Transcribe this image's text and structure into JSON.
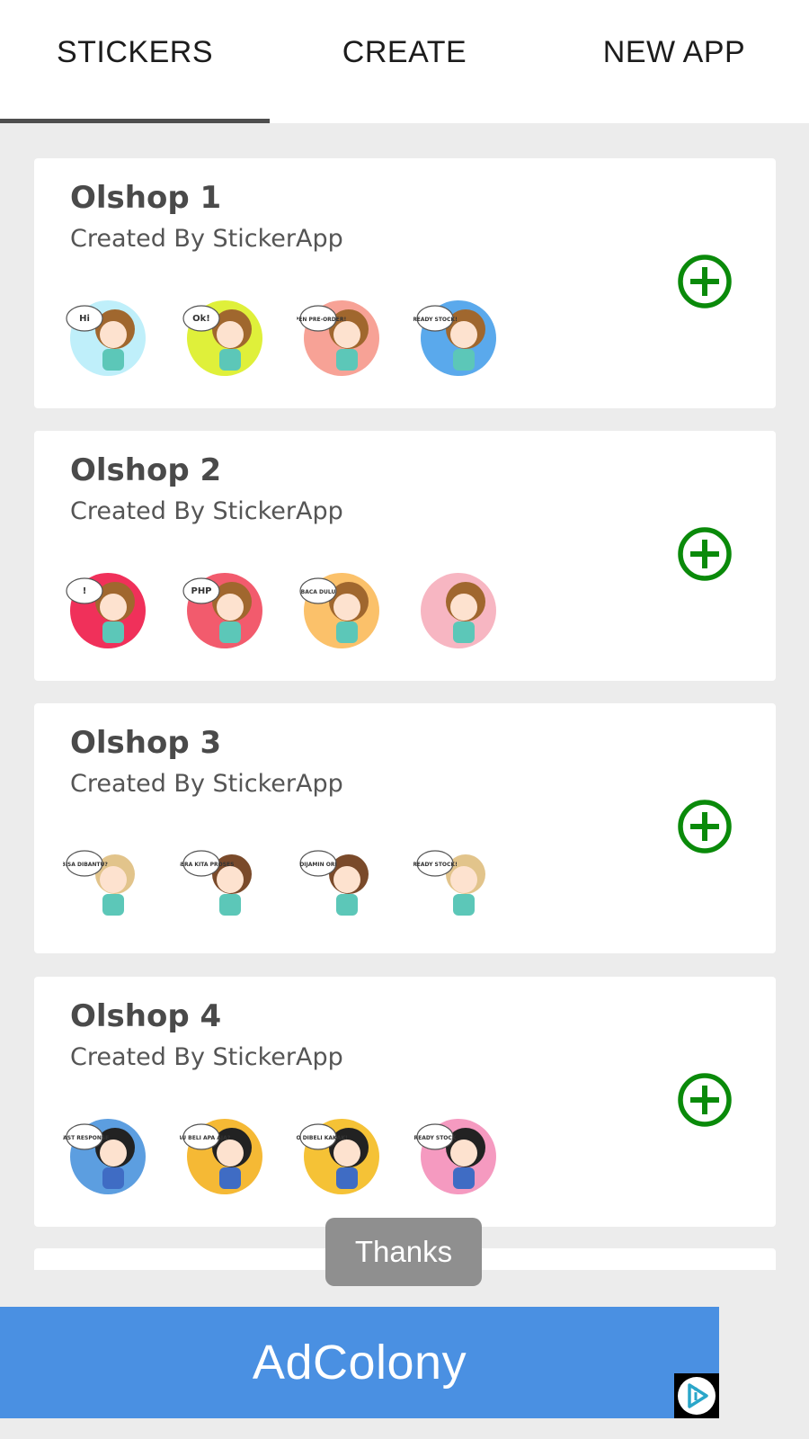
{
  "tabs": [
    {
      "label": "STICKERS",
      "active": true
    },
    {
      "label": "CREATE",
      "active": false
    },
    {
      "label": "NEW APP",
      "active": false
    }
  ],
  "packs": [
    {
      "title": "Olshop 1",
      "author": "Created By StickerApp",
      "stickers": [
        {
          "bg": "#bfeffa",
          "text": "Hi"
        },
        {
          "bg": "#dff03a",
          "text": "Ok!"
        },
        {
          "bg": "#f7a296",
          "text": "OPEN PRE-ORDER!"
        },
        {
          "bg": "#5aa9ec",
          "text": "READY STOCK!"
        }
      ]
    },
    {
      "title": "Olshop 2",
      "author": "Created By StickerApp",
      "stickers": [
        {
          "bg": "#f0305a",
          "text": "!"
        },
        {
          "bg": "#f25b6d",
          "text": "PHP"
        },
        {
          "bg": "#fbc16a",
          "text": "BACA DULU"
        },
        {
          "bg": "#f7b6c2",
          "text": ""
        }
      ]
    },
    {
      "title": "Olshop 3",
      "author": "Created By StickerApp",
      "stickers": [
        {
          "bg": "#ffffff",
          "text": "BISA DIBANTU?"
        },
        {
          "bg": "#ffffff",
          "text": "SEGERA KITA PROSES"
        },
        {
          "bg": "#ffffff",
          "text": "DIJAMIN ORI"
        },
        {
          "bg": "#ffffff",
          "text": "READY STOCK!"
        }
      ]
    },
    {
      "title": "Olshop 4",
      "author": "Created By StickerApp",
      "stickers": [
        {
          "bg": "#5c9ee0",
          "text": "FAST RESPONSE"
        },
        {
          "bg": "#f5b935",
          "text": "MAU BELI APA AJA?"
        },
        {
          "bg": "#f5c236",
          "text": "AYO DIBELI KAKAK!"
        },
        {
          "bg": "#f59ac0",
          "text": "READY STOCK"
        }
      ]
    }
  ],
  "toast": {
    "text": "Thanks"
  },
  "ad": {
    "label": "AdColony"
  },
  "colors": {
    "add_icon": "#0a8a0a",
    "ad_background": "#4a90e2",
    "tab_indicator": "#4e4e4e",
    "page_background": "#ececec"
  }
}
